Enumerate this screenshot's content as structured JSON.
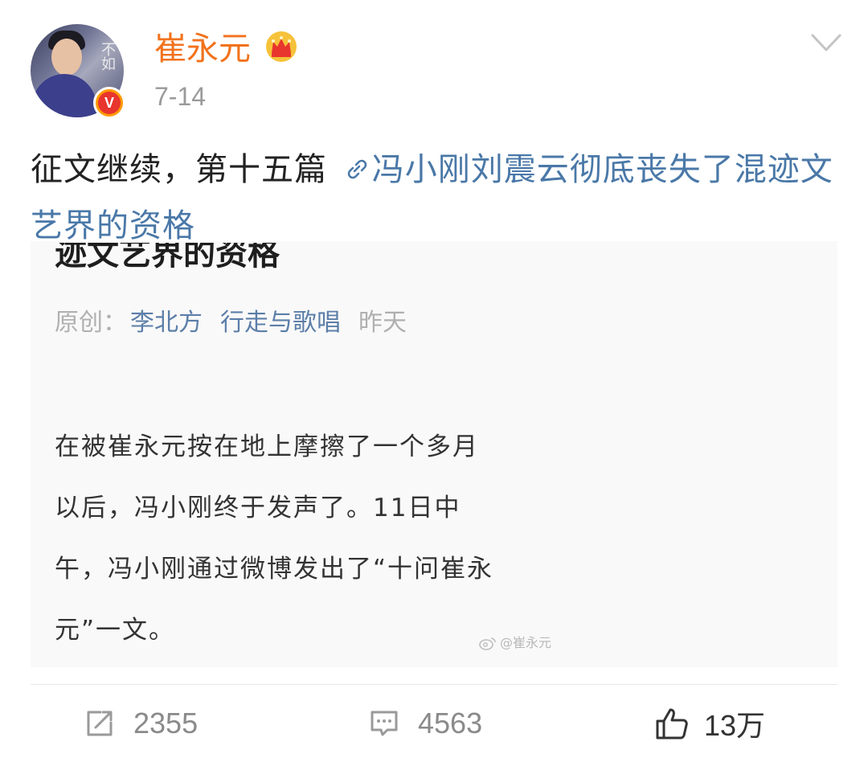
{
  "user": {
    "name": "崔永元",
    "avatar_text": "不如",
    "verified_badge": "V",
    "crown_icon": "crown-icon"
  },
  "post": {
    "time": "7-14",
    "text_prefix": "征文继续，第十五篇 ",
    "link_icon": "link-icon",
    "link_text": "冯小刚刘震云彻底丧失了混迹文艺界的资格"
  },
  "article": {
    "title_fragment": "迹文艺界的资格",
    "meta_label": "原创：",
    "author": "李北方",
    "account": "行走与歌唱",
    "date": "昨天",
    "paragraph_lines": [
      "在被崔永元按在地上摩擦了一个多月",
      "以后，冯小刚终于发声了。11日中",
      "午，冯小刚通过微博发出了“十问崔永",
      "元”一文。"
    ],
    "watermark": "@崔永元"
  },
  "actions": {
    "repost": {
      "icon": "repost-icon",
      "count": "2355"
    },
    "comment": {
      "icon": "comment-icon",
      "count": "4563"
    },
    "like": {
      "icon": "thumbs-up-icon",
      "count": "13万"
    }
  },
  "colors": {
    "username": "#f2721c",
    "link": "#4a78a8",
    "meta_blue": "#5c7ea8",
    "muted": "#9a9a9a",
    "badge_orange": "#ff9a00",
    "badge_red": "#e8352e"
  }
}
